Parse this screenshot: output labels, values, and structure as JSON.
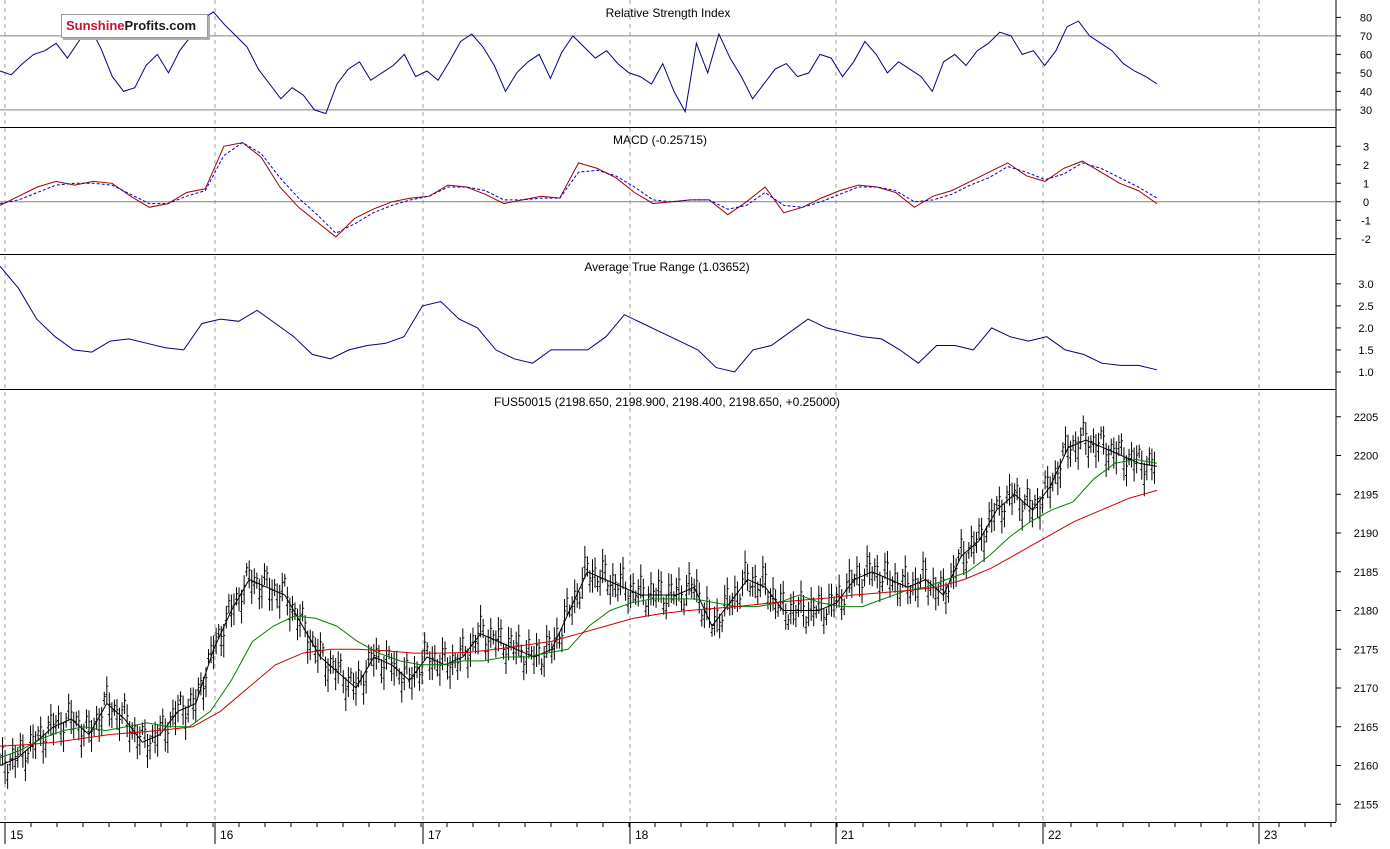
{
  "logo": {
    "part1": "Sunshine",
    "part2": "Profits.com"
  },
  "colors": {
    "price": "#000000",
    "ma_short": "#008000",
    "ma_long": "#d00000",
    "rsi": "#000080",
    "macd": "#a00000",
    "signal": "#0000c0",
    "atr": "#000080",
    "grid": "#a0a0a0",
    "frame": "#000000"
  },
  "x_axis": {
    "labels": [
      "15",
      "16",
      "17",
      "18",
      "21",
      "22",
      "23"
    ]
  },
  "chart_data": [
    {
      "type": "line",
      "title": "Relative Strength Index",
      "ylim": [
        24,
        84
      ],
      "yticks": [
        30,
        40,
        50,
        60,
        70,
        80
      ],
      "hlines": [
        30,
        70
      ],
      "series": [
        {
          "values": [
            51,
            49,
            55,
            60,
            62,
            66,
            58,
            67,
            75,
            63,
            48,
            40,
            42,
            54,
            60,
            50,
            62,
            70,
            79,
            83,
            76,
            70,
            64,
            52,
            44,
            36,
            42,
            38,
            30,
            28,
            44,
            52,
            56,
            46,
            50,
            54,
            60,
            48,
            51,
            46,
            56,
            67,
            71,
            64,
            54,
            40,
            50,
            56,
            60,
            47,
            61,
            70,
            64,
            58,
            62,
            55,
            50,
            48,
            44,
            55,
            40,
            29,
            66,
            50,
            71,
            58,
            48,
            36,
            44,
            52,
            55,
            48,
            50,
            60,
            58,
            48,
            56,
            67,
            60,
            50,
            56,
            52,
            48,
            40,
            56,
            60,
            54,
            62,
            66,
            72,
            70,
            60,
            62,
            54,
            62,
            75,
            78,
            70,
            66,
            62,
            55,
            51,
            48,
            44
          ]
        }
      ]
    },
    {
      "type": "line",
      "title": "MACD (-0.25715)",
      "ylim": [
        -2.5,
        3.5
      ],
      "yticks": [
        -2,
        -1,
        0,
        1,
        2,
        3
      ],
      "hlines": [
        0
      ],
      "series": [
        {
          "values": [
            -0.2,
            0.3,
            0.8,
            1.1,
            0.9,
            1.1,
            1.0,
            0.3,
            -0.3,
            -0.1,
            0.5,
            0.7,
            3.0,
            3.2,
            2.4,
            0.8,
            -0.3,
            -1.1,
            -1.9,
            -0.9,
            -0.4,
            0.0,
            0.2,
            0.3,
            0.9,
            0.8,
            0.4,
            -0.1,
            0.1,
            0.3,
            0.2,
            2.1,
            1.8,
            1.3,
            0.5,
            -0.1,
            0.0,
            0.1,
            0.1,
            -0.7,
            0.0,
            0.8,
            -0.6,
            -0.3,
            0.2,
            0.6,
            0.9,
            0.8,
            0.5,
            -0.3,
            0.3,
            0.6,
            1.1,
            1.6,
            2.1,
            1.4,
            1.1,
            1.8,
            2.2,
            1.6,
            1.0,
            0.6,
            -0.1
          ]
        },
        {
          "values": [
            -0.1,
            0.1,
            0.5,
            0.9,
            1.0,
            1.0,
            0.9,
            0.4,
            -0.1,
            -0.1,
            0.3,
            0.6,
            2.5,
            3.2,
            2.6,
            1.3,
            0.2,
            -0.7,
            -1.7,
            -1.2,
            -0.6,
            -0.2,
            0.1,
            0.3,
            0.8,
            0.8,
            0.6,
            0.1,
            0.1,
            0.2,
            0.2,
            1.6,
            1.7,
            1.4,
            0.8,
            0.1,
            0.0,
            0.1,
            0.1,
            -0.4,
            -0.2,
            0.5,
            -0.2,
            -0.3,
            0.0,
            0.4,
            0.8,
            0.8,
            0.6,
            0.0,
            0.1,
            0.4,
            0.9,
            1.3,
            1.9,
            1.6,
            1.2,
            1.5,
            2.1,
            1.8,
            1.3,
            0.8,
            0.2
          ]
        }
      ]
    },
    {
      "type": "line",
      "title": "Average True Range (1.03652)",
      "ylim": [
        0.75,
        3.45
      ],
      "yticks": [
        1.0,
        1.5,
        2.0,
        2.5,
        3.0
      ],
      "yticklabels": [
        "1.0",
        "1.5",
        "2.0",
        "2.5",
        "3.0"
      ],
      "series": [
        {
          "values": [
            3.4,
            2.9,
            2.2,
            1.8,
            1.5,
            1.45,
            1.7,
            1.75,
            1.65,
            1.55,
            1.5,
            2.1,
            2.2,
            2.15,
            2.4,
            2.1,
            1.8,
            1.4,
            1.3,
            1.5,
            1.6,
            1.65,
            1.8,
            2.5,
            2.6,
            2.2,
            2.0,
            1.5,
            1.3,
            1.2,
            1.5,
            1.5,
            1.5,
            1.8,
            2.3,
            2.1,
            1.9,
            1.7,
            1.5,
            1.1,
            1.0,
            1.5,
            1.6,
            1.9,
            2.2,
            2.0,
            1.9,
            1.8,
            1.75,
            1.5,
            1.2,
            1.6,
            1.6,
            1.5,
            2.0,
            1.8,
            1.7,
            1.8,
            1.5,
            1.4,
            1.2,
            1.15,
            1.15,
            1.05
          ]
        }
      ]
    },
    {
      "type": "line",
      "title": "FUS50015 (2198.650, 2198.900, 2198.400, 2198.650, +0.25000)",
      "ylim": [
        2154,
        2206
      ],
      "yticks": [
        2155,
        2160,
        2165,
        2170,
        2175,
        2180,
        2185,
        2190,
        2195,
        2200,
        2205
      ],
      "series": [
        {
          "values": [
            2160,
            2161,
            2163,
            2165,
            2166,
            2164,
            2168,
            2166,
            2163,
            2164,
            2167,
            2168,
            2175,
            2180,
            2184,
            2183,
            2182,
            2178,
            2174,
            2172,
            2170,
            2174,
            2173,
            2171,
            2174,
            2173,
            2174,
            2177,
            2176,
            2175,
            2174,
            2175,
            2180,
            2185,
            2184,
            2183,
            2182,
            2182,
            2182,
            2183,
            2178,
            2181,
            2184,
            2183,
            2180,
            2180,
            2180,
            2181,
            2184,
            2185,
            2184,
            2183,
            2184,
            2182,
            2187,
            2189,
            2193,
            2195,
            2193,
            2196,
            2201,
            2202,
            2201,
            2200,
            2199,
            2198.6
          ]
        },
        {
          "values": [
            2161,
            2162,
            2163.5,
            2164.5,
            2165,
            2164.5,
            2165,
            2165.5,
            2165,
            2165,
            2167,
            2171,
            2176,
            2178,
            2179.3,
            2179,
            2178,
            2176,
            2174.5,
            2173.5,
            2173,
            2173,
            2173.5,
            2173.5,
            2174,
            2174,
            2174.5,
            2175,
            2178,
            2180,
            2181,
            2181.5,
            2181.5,
            2181.5,
            2181,
            2180.5,
            2180.5,
            2181,
            2182,
            2181,
            2180.5,
            2180.5,
            2181.5,
            2182.5,
            2183,
            2184,
            2185,
            2187,
            2189.5,
            2191.5,
            2193,
            2194,
            2197,
            2199,
            2199.5,
            2199
          ]
        },
        {
          "values": [
            2162.5,
            2162.7,
            2163,
            2163.5,
            2164,
            2164.3,
            2164.6,
            2165,
            2167,
            2170,
            2173,
            2174.5,
            2175,
            2175,
            2174.8,
            2174.5,
            2174.5,
            2174.6,
            2175,
            2175.5,
            2176,
            2177,
            2178,
            2179,
            2179.6,
            2180,
            2180.3,
            2180.6,
            2181,
            2181.3,
            2181.6,
            2182,
            2182.3,
            2182.6,
            2183,
            2184,
            2185.5,
            2187.5,
            2189.5,
            2191.5,
            2193,
            2194.5,
            2195.5
          ]
        }
      ]
    }
  ]
}
